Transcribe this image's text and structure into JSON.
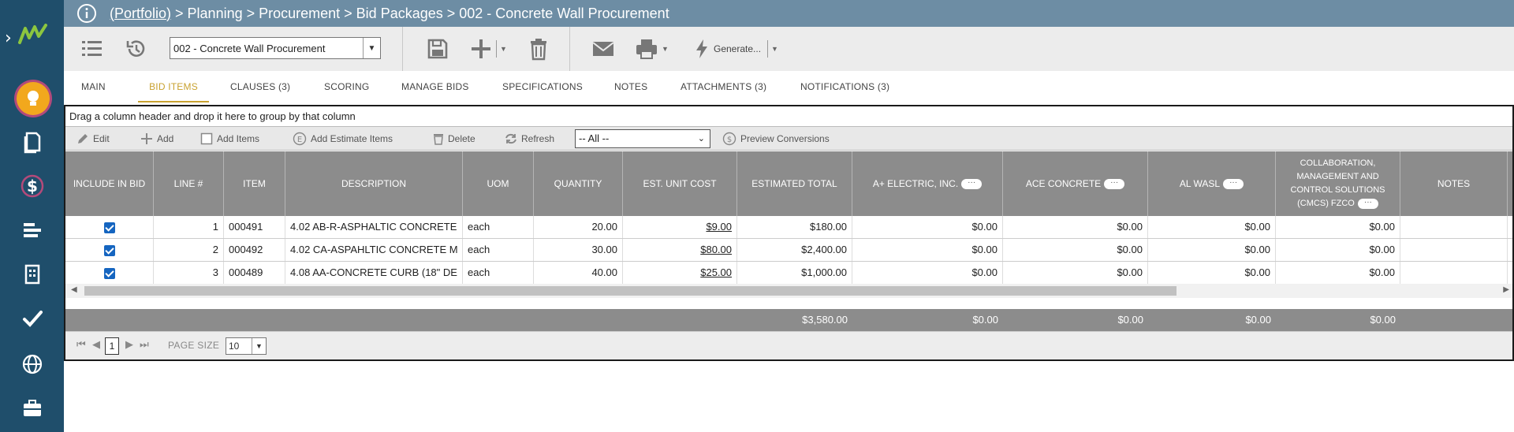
{
  "header": {
    "crumb_root": "(Portfolio)",
    "crumb_rest": " > Planning > Procurement > Bid Packages > 002 - Concrete Wall Procurement"
  },
  "toolbar": {
    "record_select": "002 -  Concrete Wall Procurement",
    "generate_label": "Generate..."
  },
  "tabs": [
    {
      "label": "MAIN"
    },
    {
      "label": "BID ITEMS"
    },
    {
      "label": "CLAUSES (3)"
    },
    {
      "label": "SCORING"
    },
    {
      "label": "MANAGE BIDS"
    },
    {
      "label": "SPECIFICATIONS"
    },
    {
      "label": "NOTES"
    },
    {
      "label": "ATTACHMENTS (3)"
    },
    {
      "label": "NOTIFICATIONS (3)"
    }
  ],
  "grid": {
    "group_hint": "Drag a column header and drop it here to group by that column",
    "tools": {
      "edit": "Edit",
      "add": "Add",
      "add_items": "Add Items",
      "add_estimate_items": "Add Estimate Items",
      "delete": "Delete",
      "refresh": "Refresh",
      "filter": "-- All --",
      "preview_conversions": "Preview Conversions"
    },
    "columns": {
      "include": "INCLUDE IN BID",
      "line": "LINE #",
      "item": "ITEM",
      "description": "DESCRIPTION",
      "uom": "UOM",
      "quantity": "QUANTITY",
      "unit_cost": "EST. UNIT COST",
      "est_total": "ESTIMATED TOTAL",
      "v1": "A+ ELECTRIC, INC.",
      "v2": "ACE CONCRETE",
      "v3": "AL WASL",
      "v4": "COLLABORATION, MANAGEMENT AND CONTROL SOLUTIONS (CMCS) FZCO",
      "notes": "NOTES",
      "vendor_menu": "···"
    },
    "rows": [
      {
        "line": "1",
        "item": "000491",
        "description": "4.02 AB-R-ASPHALTIC CONCRETE",
        "uom": "each",
        "quantity": "20.00",
        "unit_cost": "$9.00",
        "est_total": "$180.00",
        "v1": "$0.00",
        "v2": "$0.00",
        "v3": "$0.00",
        "v4": "$0.00"
      },
      {
        "line": "2",
        "item": "000492",
        "description": "4.02 CA-ASPAHLTIC CONCRETE M",
        "uom": "each",
        "quantity": "30.00",
        "unit_cost": "$80.00",
        "est_total": "$2,400.00",
        "v1": "$0.00",
        "v2": "$0.00",
        "v3": "$0.00",
        "v4": "$0.00"
      },
      {
        "line": "3",
        "item": "000489",
        "description": "4.08 AA-CONCRETE CURB (18\" DE",
        "uom": "each",
        "quantity": "40.00",
        "unit_cost": "$25.00",
        "est_total": "$1,000.00",
        "v1": "$0.00",
        "v2": "$0.00",
        "v3": "$0.00",
        "v4": "$0.00"
      }
    ],
    "totals": {
      "est_total": "$3,580.00",
      "v1": "$0.00",
      "v2": "$0.00",
      "v3": "$0.00",
      "v4": "$0.00"
    },
    "pager": {
      "page": "1",
      "page_size_label": "PAGE SIZE",
      "page_size": "10"
    }
  },
  "colors": {
    "sidebar": "#1f4e6b",
    "header": "#6d8da4",
    "accent": "#c9a230",
    "grid_header": "#8c8c8c"
  }
}
